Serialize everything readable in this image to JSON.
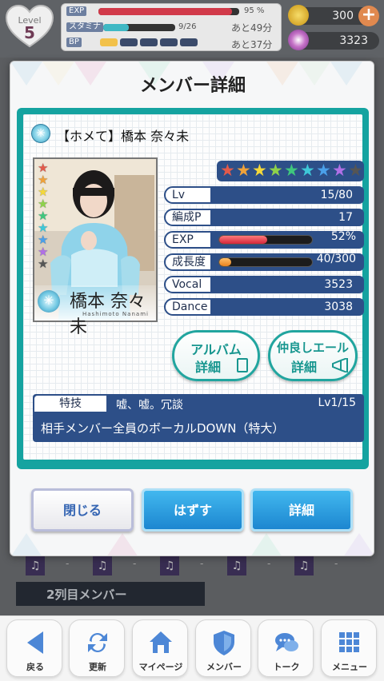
{
  "status": {
    "level_label": "Level",
    "level_value": "5",
    "exp_label": "EXP",
    "exp_percent_text": "95 %",
    "exp_fill": 0.95,
    "stamina_label": "スタミナ",
    "stamina_text": "9/26",
    "stamina_fill": 0.35,
    "stamina_recover": "あと49分",
    "bp_label": "BP",
    "bp_filled": 1,
    "bp_total": 5,
    "bp_recover": "あと37分"
  },
  "currency": {
    "coins": "300",
    "coin_plus": "+",
    "gems": "3323"
  },
  "background": {
    "slot_dash": "-",
    "row2_label": "2列目メンバー"
  },
  "modal": {
    "title": "メンバー詳細",
    "member_name": "【ホメて】橋本 奈々未",
    "card_name_jp": "橋本 奈々未",
    "card_name_romaji": "Hashimoto Nanami",
    "rarity_stars": [
      "#e35a4a",
      "#f0a23a",
      "#f4d83a",
      "#8ed24a",
      "#3fc77d",
      "#3ec8d8",
      "#4aa0ea",
      "#b070e6",
      "#555555"
    ],
    "stats": {
      "lv_label": "Lv",
      "lv_value": "15/80",
      "formation_label": "編成P",
      "formation_value": "17",
      "exp_label": "EXP",
      "exp_value": "52%",
      "exp_fill": 0.52,
      "growth_label": "成長度",
      "growth_value": "40/300",
      "growth_fill": 0.133,
      "vocal_label": "Vocal",
      "vocal_value": "3523",
      "dance_label": "Dance",
      "dance_value": "3038"
    },
    "album_btn_line1": "アルバム",
    "album_btn_line2": "詳細",
    "cheer_btn_line1": "仲良しエール",
    "cheer_btn_line2": "詳細",
    "skill_label": "特技",
    "skill_name": "嘘、嘘。冗談",
    "skill_level": "Lv1/15",
    "skill_desc": "相手メンバー全員のボーカルDOWN（特大）",
    "btn_close": "閉じる",
    "btn_remove": "はずす",
    "btn_detail": "詳細"
  },
  "nav": {
    "back": "戻る",
    "refresh": "更新",
    "mypage": "マイページ",
    "member": "メンバー",
    "talk": "トーク",
    "menu": "メニュー"
  },
  "colors": {
    "teal": "#15a3a0",
    "navy": "#2d4f88",
    "blue_btn": "#1c86d0"
  }
}
